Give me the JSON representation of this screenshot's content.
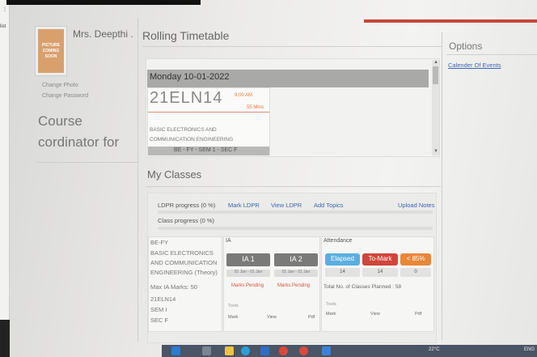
{
  "edge": {
    "top_text": "⋮",
    "list_text": "list"
  },
  "profile": {
    "photo_placeholder": "PICTURE COMING SOON",
    "name": "Mrs. Deepthi .",
    "change_photo": "Change Photo",
    "change_password": "Change Password",
    "role_title": "Course cordinator for"
  },
  "rolling": {
    "title": "Rolling Timetable",
    "day": "Monday 10-01-2022",
    "class_code": "21ELN14",
    "time": "9:00 AM",
    "duration": "55 Mins",
    "subject": "BASIC ELECTRONICS AND COMMUNICATION ENGINEERING",
    "section": "BE - FY - SEM 1 - SEC F"
  },
  "my_classes": {
    "title": "My Classes",
    "ldpr_progress": "LDPR progress (0 %)",
    "mark_ldpr": "Mark LDPR",
    "view_ldpr": "View LDPR",
    "add_topics": "Add Topics",
    "upload_notes": "Upload Notes",
    "class_progress": "Class progress (0 %)",
    "ldpr_percent": 0,
    "class_percent": 0,
    "course": {
      "program": "BE-FY",
      "subject_l1": "BASIC ELECTRONICS",
      "subject_l2": "AND COMMUNICATION",
      "subject_l3": "ENGINEERING (Theory)",
      "max_ia": "Max IA Marks: 50",
      "code": "21ELN14",
      "sem": "SEM I",
      "sec": "SEC F"
    },
    "ia": {
      "header": "IA",
      "ia1": "IA 1",
      "ia2": "IA 2",
      "ia1_date": "01 Jan - 01 Jan",
      "ia2_date": "01 Jan - 01 Jan",
      "ia1_status": "Marks Pending",
      "ia2_status": "Marks Pending",
      "tools": "Tools",
      "mark": "Mark",
      "view": "View",
      "pdf": "Pdf"
    },
    "attendance": {
      "header": "Attendance",
      "elapsed": "Elapsed",
      "to_mark": "To-Mark",
      "lt85": "< 85%",
      "elapsed_count": "14",
      "to_mark_count": "14",
      "lt85_count": "0",
      "planned": "Total No. of Classes Planned : 58",
      "tools": "Tools",
      "mark": "Mark",
      "view": "View",
      "pdf": "Pdf"
    },
    "colors": {
      "elapsed": "#5aaee0",
      "to_mark": "#d0453a",
      "lt85": "#e8873a",
      "ia_button": "#7a7a78",
      "link": "#3c66b0"
    }
  },
  "options": {
    "title": "Options",
    "calendar_link": "Calender Of Events"
  },
  "taskbar": {
    "temperature": "22°C",
    "lang": "ENG",
    "icons": [
      "search-icon",
      "widgets-icon",
      "folder-icon",
      "edge-icon",
      "store-icon",
      "chrome-icon",
      "outlook-icon",
      "teams-icon"
    ]
  }
}
